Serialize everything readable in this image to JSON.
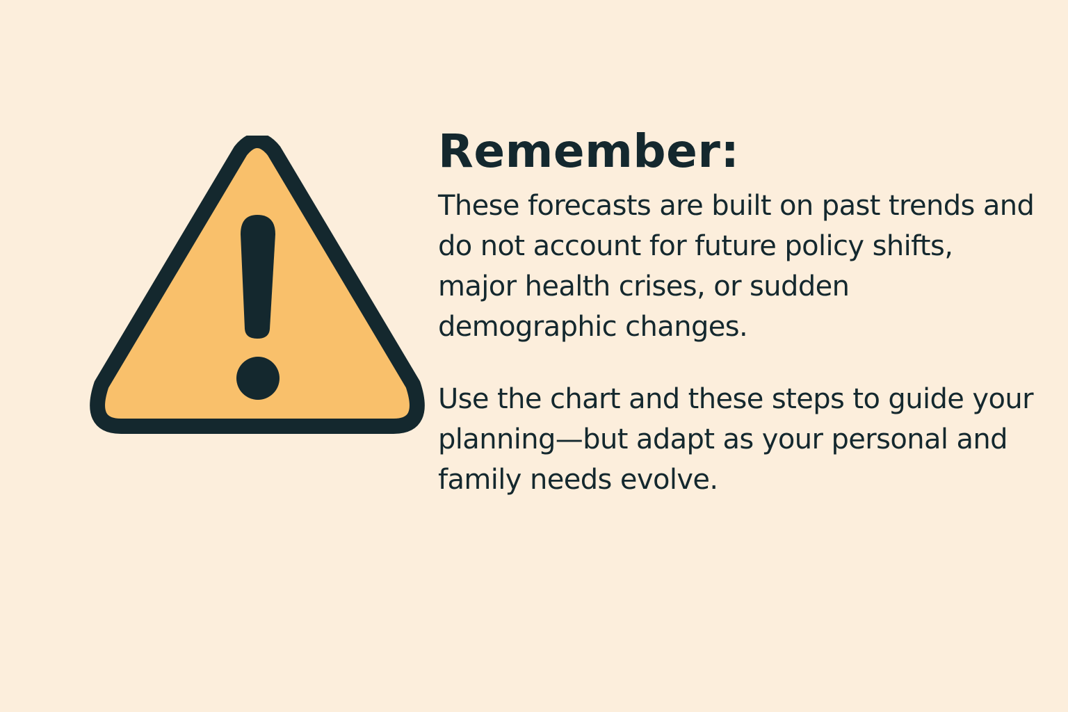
{
  "notice": {
    "title": "Remember:",
    "icon": "warning-triangle-icon",
    "paragraphs": [
      "These forecasts are built on past trends and do not account for future policy shifts, major health crises, or sudden demographic changes.",
      "Use the chart and these steps to guide your planning—but adapt as your personal and family needs evolve."
    ]
  },
  "colors": {
    "background": "#FCEEDC",
    "text": "#14282E",
    "triangle_fill": "#F9C06B",
    "triangle_outline": "#14282E"
  }
}
